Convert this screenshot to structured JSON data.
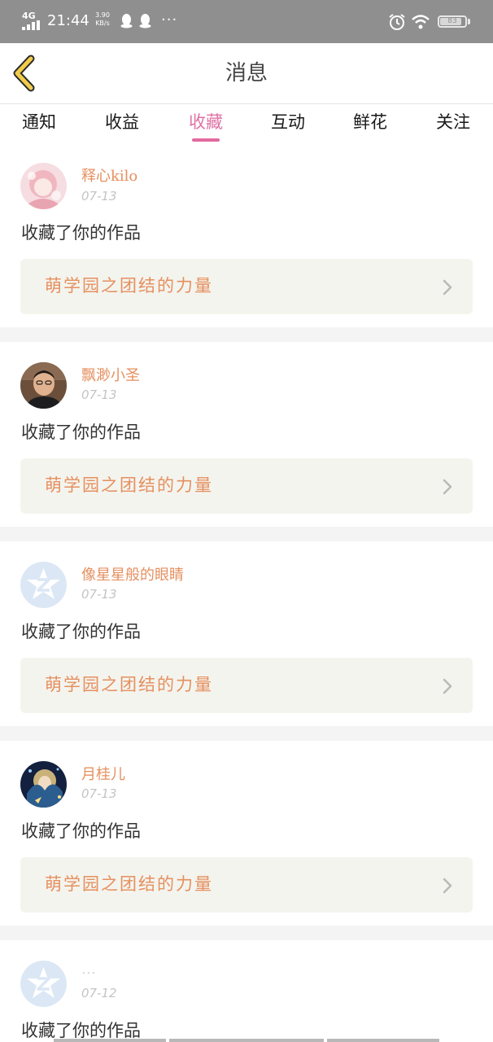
{
  "status_bar": {
    "network": "4G",
    "time": "21:44",
    "speed_value": "3.90",
    "speed_unit": "KB/s",
    "dots": "···",
    "battery": "83",
    "icons": [
      "signal-icon",
      "qq-icon",
      "alarm-icon",
      "wifi-icon",
      "battery-icon"
    ]
  },
  "header": {
    "title": "消息",
    "back_icon": "back-arrow-icon"
  },
  "tabs": [
    {
      "label": "通知",
      "active": false
    },
    {
      "label": "收益",
      "active": false
    },
    {
      "label": "收藏",
      "active": true
    },
    {
      "label": "互动",
      "active": false
    },
    {
      "label": "鲜花",
      "active": false
    },
    {
      "label": "关注",
      "active": false
    }
  ],
  "accent_color": "#e36aa0",
  "name_color": "#e59060",
  "messages": [
    {
      "user": "释心kilo",
      "date": "07-13",
      "action": "收藏了你的作品",
      "work": "萌学园之团结的力量",
      "avatar": "anime-girl-avatar"
    },
    {
      "user": "飘渺小圣",
      "date": "07-13",
      "action": "收藏了你的作品",
      "work": "萌学园之团结的力量",
      "avatar": "photo-avatar"
    },
    {
      "user": "像星星般的眼睛",
      "date": "07-13",
      "action": "收藏了你的作品",
      "work": "萌学园之团结的力量",
      "avatar": "default-avatar"
    },
    {
      "user": "月桂儿",
      "date": "07-13",
      "action": "收藏了你的作品",
      "work": "萌学园之团结的力量",
      "avatar": "anime-avatar"
    },
    {
      "user": "…",
      "date": "07-12",
      "action": "收藏了你的作品",
      "work": "",
      "avatar": "default-avatar"
    }
  ]
}
